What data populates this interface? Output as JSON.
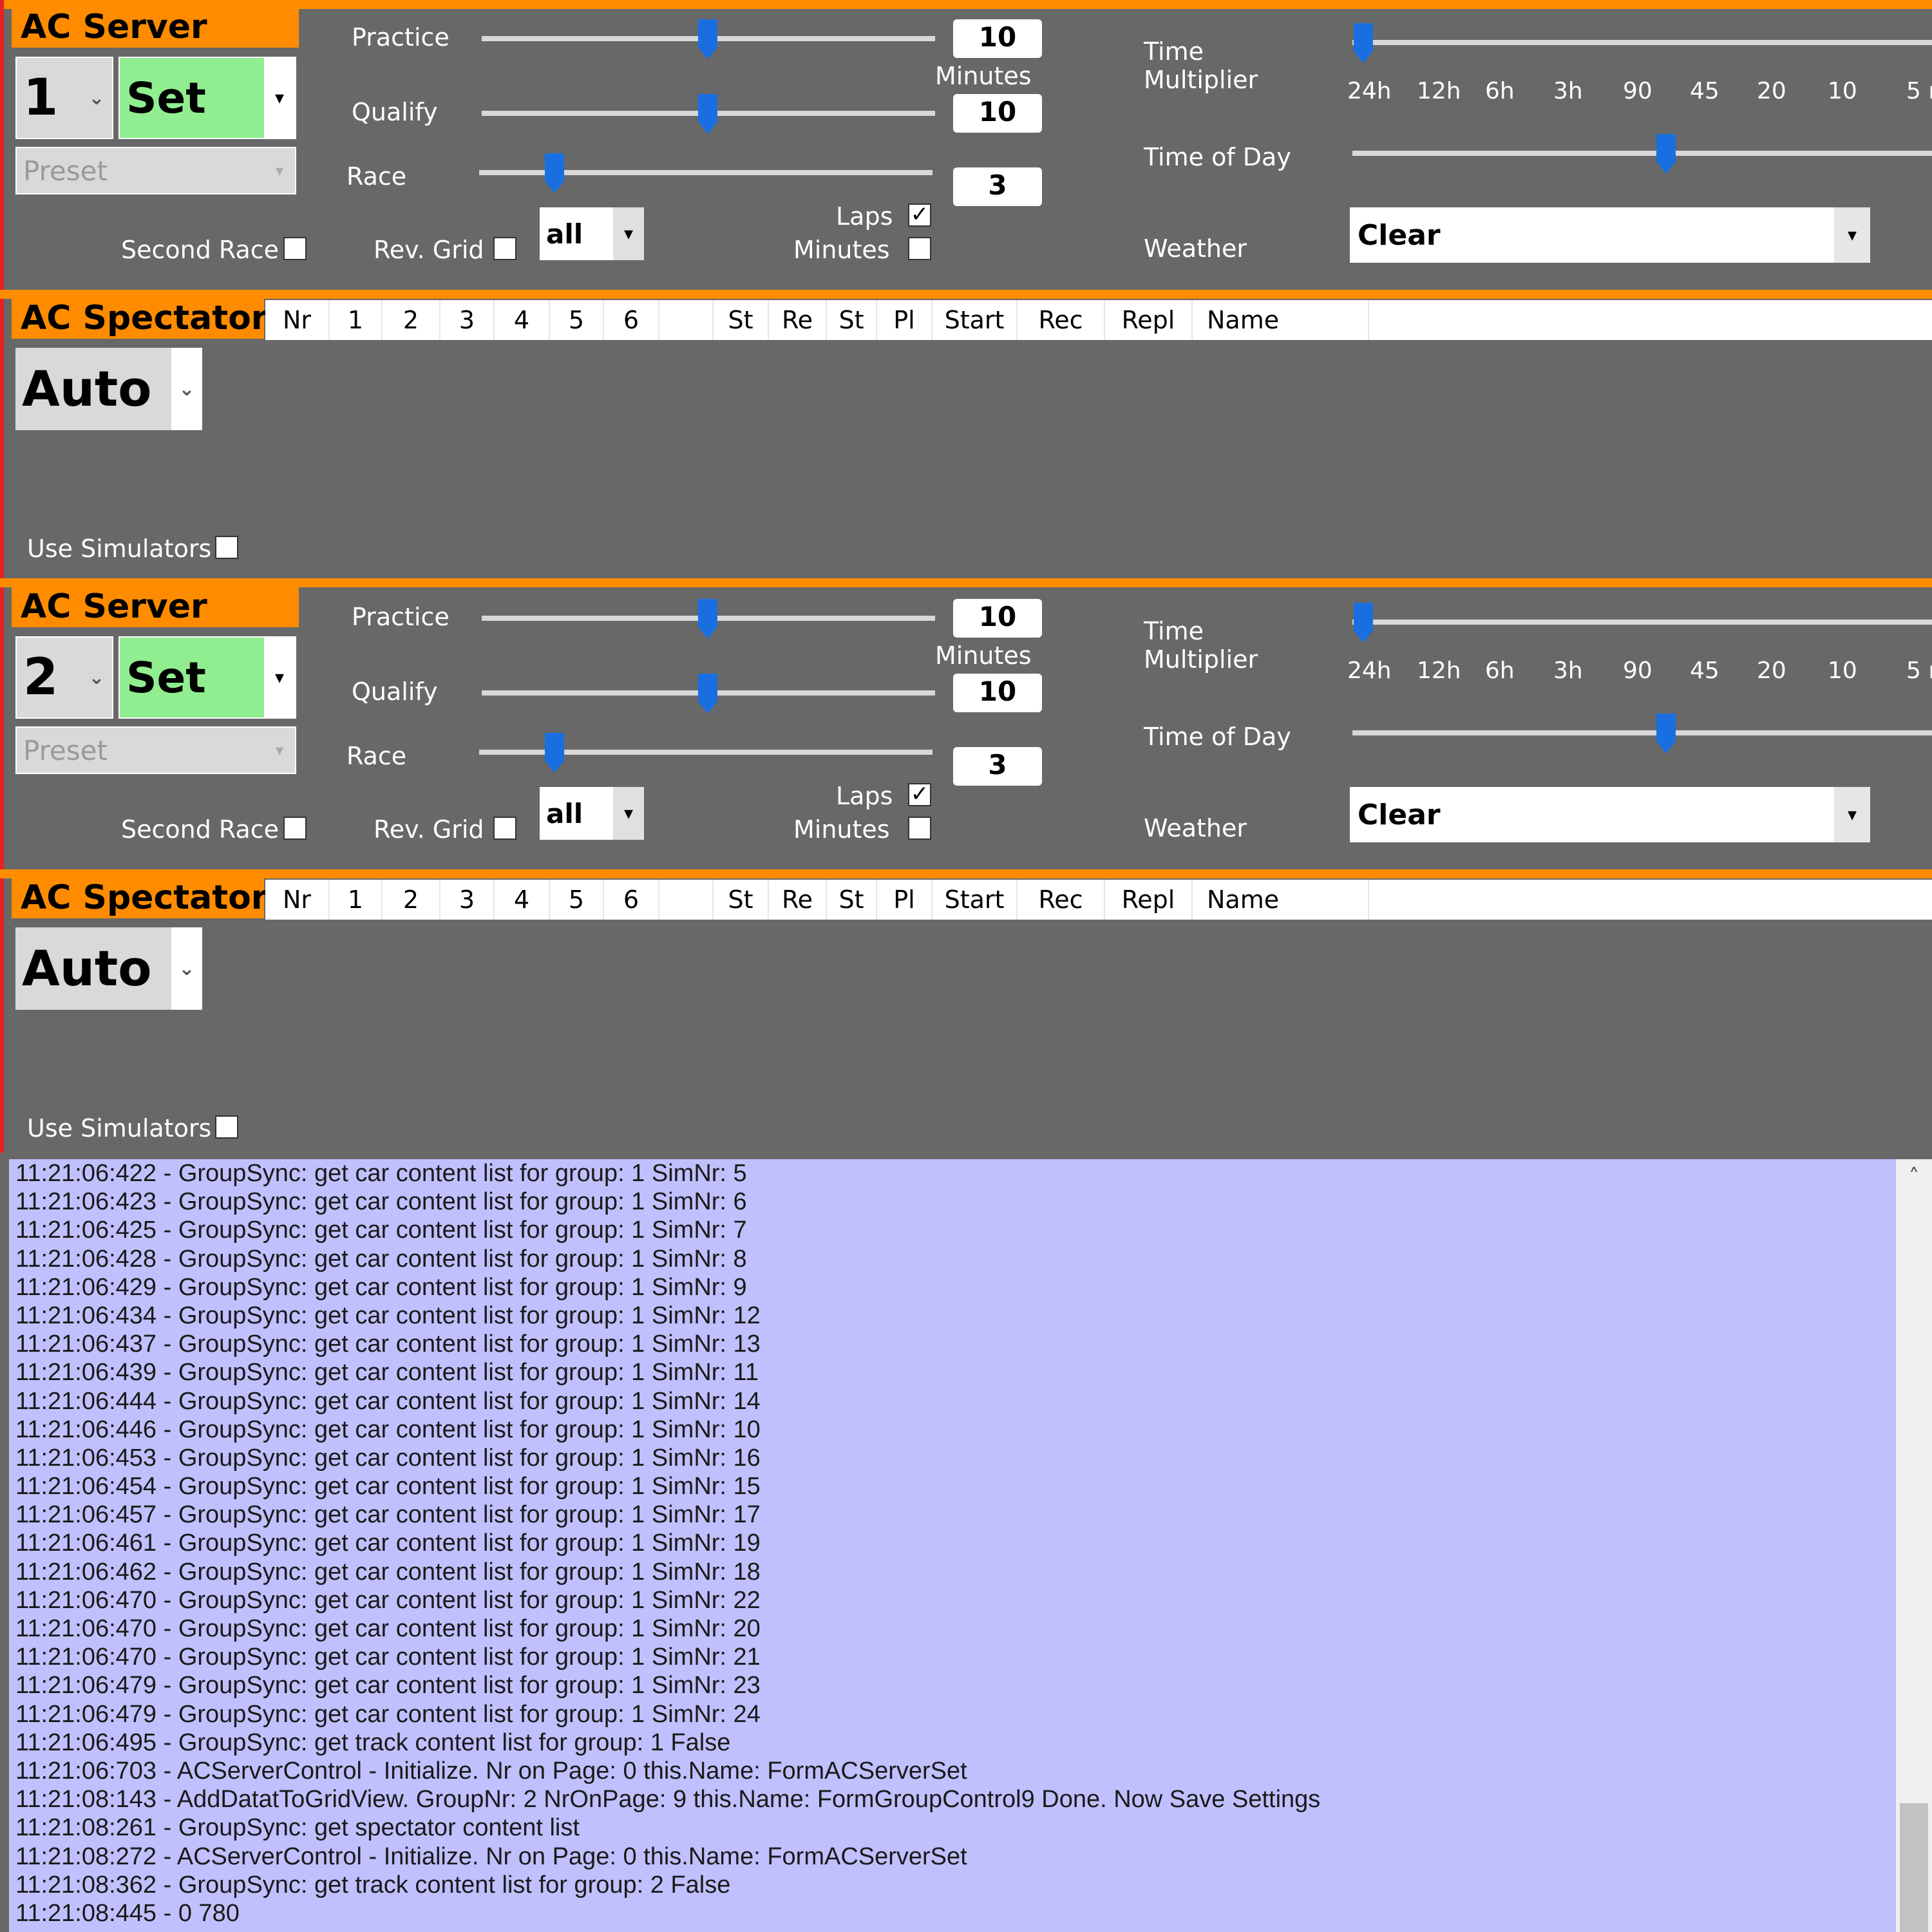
{
  "colors": {
    "accent_orange": "#ff8c00",
    "panel_bg": "#686868",
    "set_green": "#90ee90",
    "log_bg": "#c0c0ff",
    "slider_blue": "#1a6fe0"
  },
  "server_panels": [
    {
      "title": "AC Server",
      "server_number": "1",
      "set_label": "Set",
      "preset_placeholder": "Preset",
      "practice_label": "Practice",
      "practice_value": "10",
      "minutes_caption": "Minutes",
      "qualify_label": "Qualify",
      "qualify_value": "10",
      "race_label": "Race",
      "race_value": "3",
      "second_race_label": "Second Race",
      "rev_grid_label": "Rev. Grid",
      "grid_select": "all",
      "laps_label": "Laps",
      "laps_checked": true,
      "minutes_label": "Minutes",
      "minutes_checked": false,
      "time_multiplier_label": "Time Multiplier",
      "multiplier_ticks": [
        "24h",
        "12h",
        "6h",
        "3h",
        "90",
        "45",
        "20",
        "10",
        "5 r"
      ],
      "time_of_day_label": "Time of Day",
      "weather_label": "Weather",
      "weather_value": "Clear"
    },
    {
      "title": "AC Server",
      "server_number": "2",
      "set_label": "Set",
      "preset_placeholder": "Preset",
      "practice_label": "Practice",
      "practice_value": "10",
      "minutes_caption": "Minutes",
      "qualify_label": "Qualify",
      "qualify_value": "10",
      "race_label": "Race",
      "race_value": "3",
      "second_race_label": "Second Race",
      "rev_grid_label": "Rev. Grid",
      "grid_select": "all",
      "laps_label": "Laps",
      "laps_checked": true,
      "minutes_label": "Minutes",
      "minutes_checked": false,
      "time_multiplier_label": "Time Multiplier",
      "multiplier_ticks": [
        "24h",
        "12h",
        "6h",
        "3h",
        "90",
        "45",
        "20",
        "10",
        "5 r"
      ],
      "time_of_day_label": "Time of Day",
      "weather_label": "Weather",
      "weather_value": "Clear"
    }
  ],
  "spectator_panels": [
    {
      "title": "AC Spectator",
      "mode": "Auto",
      "use_simulators_label": "Use Simulators",
      "columns": [
        "Nr",
        "1",
        "2",
        "3",
        "4",
        "5",
        "6",
        "",
        "St",
        "Re",
        "St",
        "Pl",
        "Start",
        "Rec",
        "Repl",
        "Name"
      ]
    },
    {
      "title": "AC Spectator",
      "mode": "Auto",
      "use_simulators_label": "Use Simulators",
      "columns": [
        "Nr",
        "1",
        "2",
        "3",
        "4",
        "5",
        "6",
        "",
        "St",
        "Re",
        "St",
        "Pl",
        "Start",
        "Rec",
        "Repl",
        "Name"
      ]
    }
  ],
  "log_lines": [
    "11:21:06:422 - GroupSync: get car content list for group: 1  SimNr: 5",
    "11:21:06:423 - GroupSync: get car content list for group: 1  SimNr: 6",
    "11:21:06:425 - GroupSync: get car content list for group: 1  SimNr: 7",
    "11:21:06:428 - GroupSync: get car content list for group: 1  SimNr: 8",
    "11:21:06:429 - GroupSync: get car content list for group: 1  SimNr: 9",
    "11:21:06:434 - GroupSync: get car content list for group: 1  SimNr: 12",
    "11:21:06:437 - GroupSync: get car content list for group: 1  SimNr: 13",
    "11:21:06:439 - GroupSync: get car content list for group: 1  SimNr: 11",
    "11:21:06:444 - GroupSync: get car content list for group: 1  SimNr: 14",
    "11:21:06:446 - GroupSync: get car content list for group: 1  SimNr: 10",
    "11:21:06:453 - GroupSync: get car content list for group: 1  SimNr: 16",
    "11:21:06:454 - GroupSync: get car content list for group: 1  SimNr: 15",
    "11:21:06:457 - GroupSync: get car content list for group: 1  SimNr: 17",
    "11:21:06:461 - GroupSync: get car content list for group: 1  SimNr: 19",
    "11:21:06:462 - GroupSync: get car content list for group: 1  SimNr: 18",
    "11:21:06:470 - GroupSync: get car content list for group: 1  SimNr: 22",
    "11:21:06:470 - GroupSync: get car content list for group: 1  SimNr: 20",
    "11:21:06:470 - GroupSync: get car content list for group: 1  SimNr: 21",
    "11:21:06:479 - GroupSync: get car content list for group: 1  SimNr: 23",
    "11:21:06:479 - GroupSync: get car content list for group: 1  SimNr: 24",
    "11:21:06:495 - GroupSync: get track content list for group: 1  False",
    "11:21:06:703 - ACServerControl - Initialize. Nr on Page: 0 this.Name: FormACServerSet",
    "11:21:08:143 - AddDatatToGridView. GroupNr: 2  NrOnPage: 9  this.Name: FormGroupControl9  Done. Now Save Settings",
    "11:21:08:261 - GroupSync: get spectator content list",
    "11:21:08:272 - ACServerControl - Initialize. Nr on Page: 0 this.Name: FormACServerSet",
    "11:21:08:362 - GroupSync: get track content list for group: 2  False",
    "11:21:08:445 - 0  780"
  ]
}
